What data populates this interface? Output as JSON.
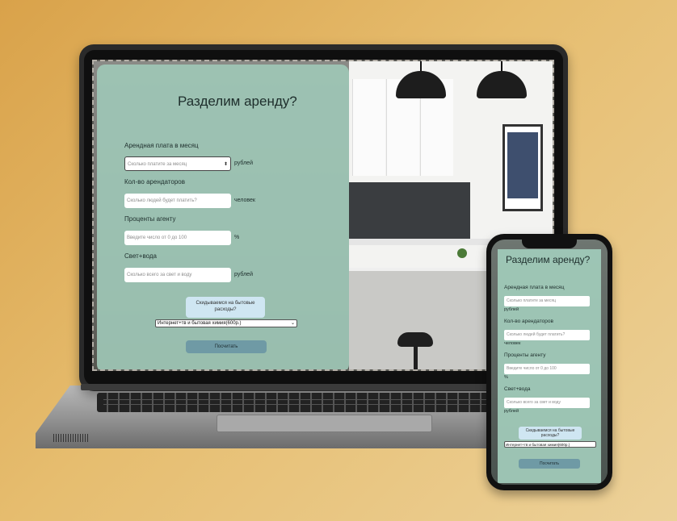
{
  "colors": {
    "background": "#e2b86b",
    "panel": "#9ec7b6",
    "blue_button": "#cfe6f2",
    "calc_button": "#6f9aa5"
  },
  "form": {
    "title": "Разделим аренду?",
    "rent_label": "Арендная плата в месяц",
    "rent_placeholder": "Сколько платите за месяц",
    "rent_unit": "рублей",
    "tenants_label": "Кол-во арендаторов",
    "tenants_placeholder": "Сколько людей будет платить?",
    "tenants_unit": "человек",
    "agent_label": "Проценты агенту",
    "agent_placeholder": "Введите число от 0 до 100",
    "agent_unit": "%",
    "utilities_label": "Свет+вода",
    "utilities_placeholder": "Сколько всего за свет и воду",
    "utilities_unit": "рублей",
    "household_button": "Скидываемся на бытовые расходы?",
    "household_select": "Интернет+тв и бытовая химия(600р.)",
    "calculate_button": "Посчитать"
  },
  "icons": {
    "select_arrow": "select-arrow-icon",
    "dropdown_chevron": "chevron-down-icon"
  }
}
